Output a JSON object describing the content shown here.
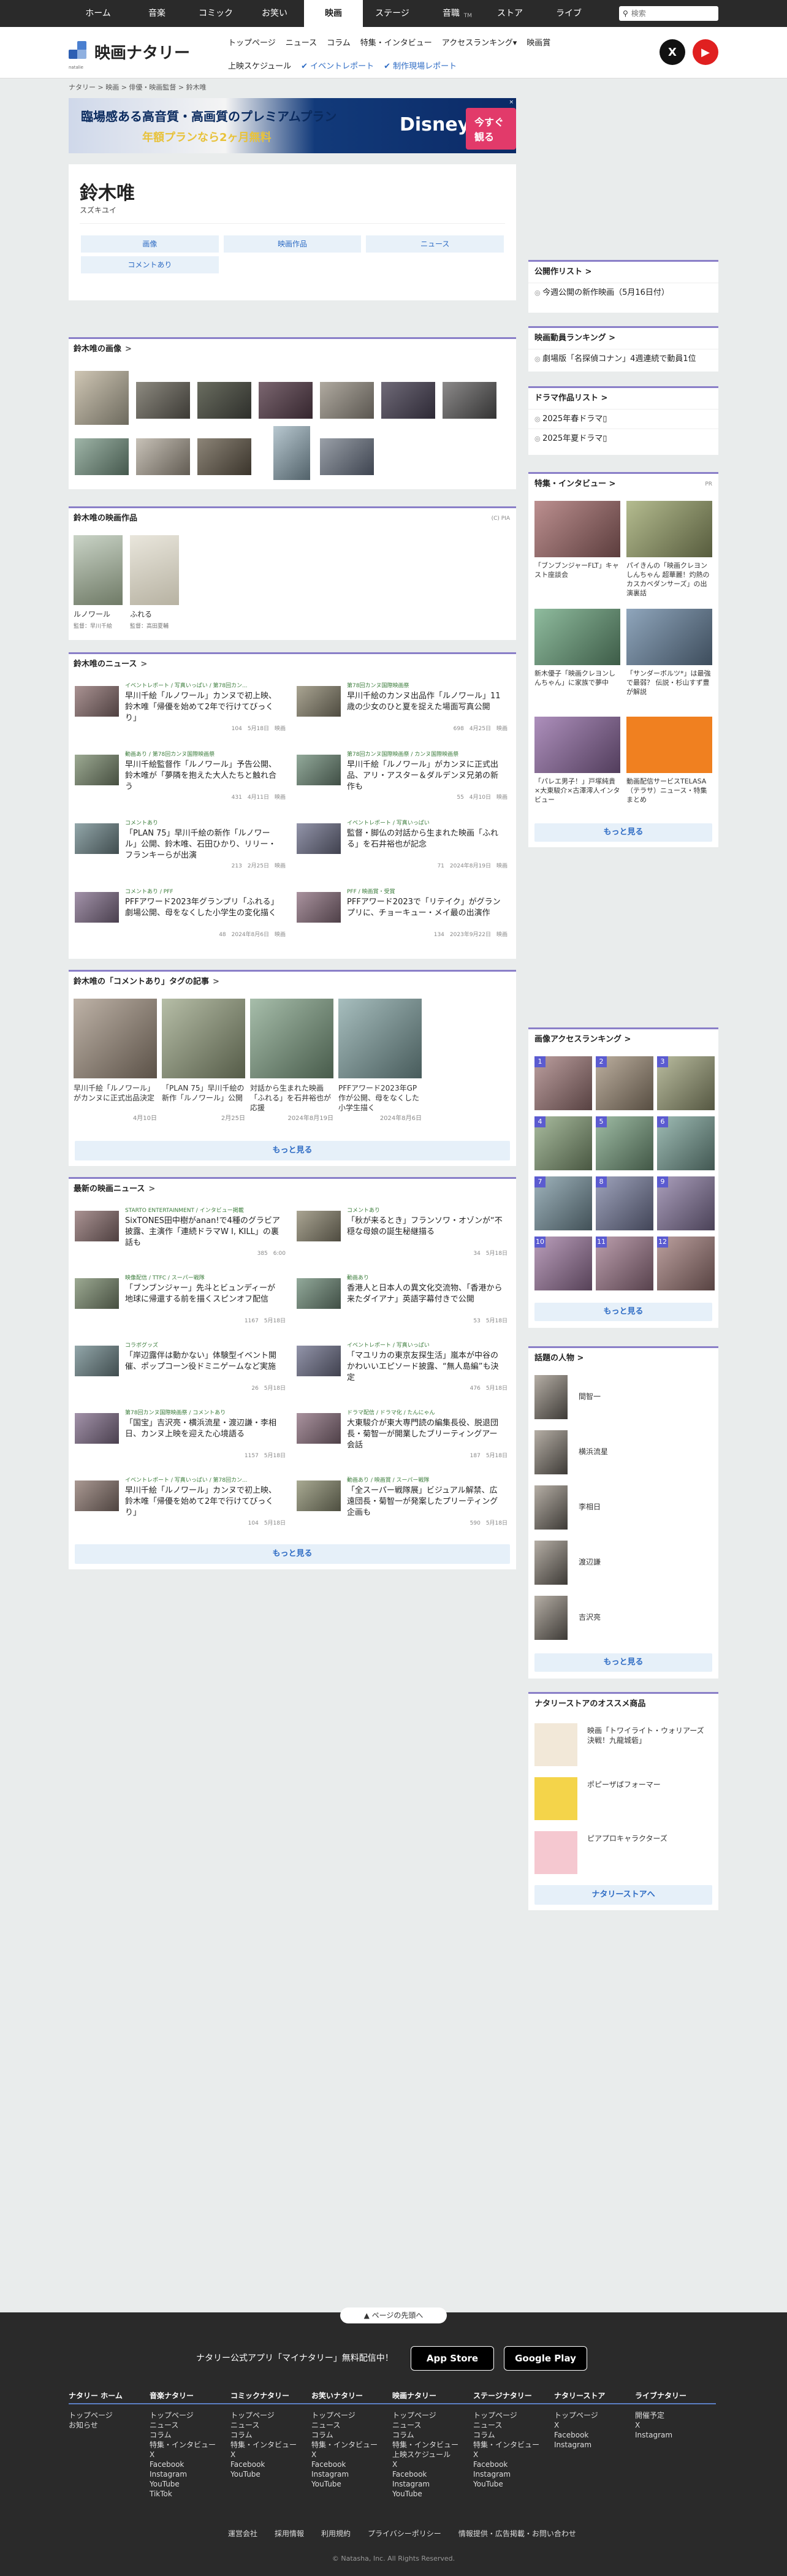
{
  "topnav": {
    "tabs": [
      "ホーム",
      "音楽",
      "コミック",
      "お笑い",
      "映画",
      "ステージ",
      "音職",
      "ストア",
      "ライブ"
    ],
    "active": 4,
    "sup": "TM",
    "search_placeholder": "検索"
  },
  "header": {
    "logo": "映画ナタリー",
    "logo_sub": "natalie",
    "nav1": [
      "トップページ",
      "ニュース",
      "コラム",
      "特集・インタビュー",
      "アクセスランキング▾",
      "映画賞"
    ],
    "nav2": [
      "上映スケジュール",
      "イベントレポート",
      "制作現場レポート"
    ]
  },
  "breadcrumb": "ナタリー > 映画 > 俳優・映画監督 > 鈴木唯",
  "ad": {
    "line1": "臨場感ある高音質・高画質のプレミアムプラン",
    "line2": "年額プランなら2ヶ月無料",
    "brand": "Disney+",
    "cta": "今すぐ観る",
    "close": "×"
  },
  "person": {
    "name": "鈴木唯",
    "kana": "スズキユイ",
    "tabs": [
      "画像",
      "映画作品",
      "ニュース",
      "コメントあり"
    ]
  },
  "images": {
    "title": "鈴木唯の画像"
  },
  "films": {
    "title": "鈴木唯の映画作品",
    "pa": "(C) PIA",
    "items": [
      {
        "title": "ルノワール",
        "dir": "監督：早川千絵"
      },
      {
        "title": "ふれる",
        "dir": "監督：高田夏輔"
      }
    ]
  },
  "news": {
    "title": "鈴木唯のニュース",
    "items": [
      {
        "tags": "イベントレポート / 写真いっぱい / 第78回カン...",
        "title": "早川千絵「ルノワール」カンヌで初上映、鈴木唯「帰優を始めて2年で行けてびっくり」",
        "meta": "104　5月18日　映画"
      },
      {
        "tags": "第78回カンヌ国際映画祭",
        "title": "早川千絵のカンヌ出品作「ルノワール」11歳の少女のひと夏を捉えた場面写真公開",
        "meta": "698　4月25日　映画"
      },
      {
        "tags": "動画あり / 第78回カンヌ国際映画祭",
        "title": "早川千絵監督作「ルノワール」予告公開、鈴木唯が「夢隣を抱えた大人たちと触れ合う",
        "meta": "431　4月11日　映画"
      },
      {
        "tags": "第78回カンヌ国際映画祭 / カンヌ国際映画祭",
        "title": "早川千絵「ルノワール」がカンヌに正式出品、アリ・アスター＆ダルデンヌ兄弟の新作も",
        "meta": "55　4月10日　映画"
      },
      {
        "tags": "コメントあり",
        "title": "「PLAN 75」早川千絵の新作「ルノワール」公開、鈴木唯、石田ひかり、リリー・フランキーらが出演",
        "meta": "213　2月25日　映画"
      },
      {
        "tags": "イベントレポート / 写真いっぱい",
        "title": "監督・脚仏の対話から生まれた映画「ふれる」を石井裕也が記念",
        "meta": "71　2024年8月19日　映画"
      },
      {
        "tags": "コメントあり / PFF",
        "title": "PFFアワード2023年グランプリ「ふれる」劇場公開、母をなくした小学生の変化描く",
        "meta": "48　2024年8月6日　映画"
      },
      {
        "tags": "PFF / 映画賞・受賞",
        "title": "PFFアワード2023で「リテイク」がグランプリに、チョーキュー・メイ最の出演作",
        "meta": "134　2023年9月22日　映画"
      }
    ]
  },
  "comment": {
    "title": "鈴木唯の「コメントあり」タグの記事",
    "more": "もっと見る",
    "items": [
      {
        "title": "早川千絵「ルノワール」がカンヌに正式出品決定",
        "date": "4月10日"
      },
      {
        "title": "「PLAN 75」早川千絵の新作「ルノワール」公開",
        "date": "2月25日"
      },
      {
        "title": "対話から生まれた映画「ふれる」を石井裕也が応援",
        "date": "2024年8月19日"
      },
      {
        "title": "PFFアワード2023年GP作が公開、母をなくした小学生描く",
        "date": "2024年8月6日"
      }
    ]
  },
  "latest": {
    "title": "最新の映画ニュース",
    "more": "もっと見る",
    "items": [
      {
        "tags": "STARTO ENTERTAINMENT / インタビュー掲載",
        "title": "SixTONES田中樹がanan!で4種のグラビア披露、主演作「連続ドラマW I, KILL」の裏話も",
        "meta": "385　6:00"
      },
      {
        "tags": "コメントあり",
        "title": "「秋が来るとき」フランソワ・オゾンが“不穏な母娘の誕生秘継描る",
        "meta": "34　5月18日"
      },
      {
        "tags": "映像配信 / TTFC / スーパー戦隊",
        "title": "「ブンブンジャー」先斗とビュンディーが地球に帰還する前を描くスピンオフ配信",
        "meta": "1167　5月18日"
      },
      {
        "tags": "動画あり",
        "title": "香港人と日本人の異文化交流物、「香港から来たダイアナ」英語字幕付きで公開",
        "meta": "53　5月18日"
      },
      {
        "tags": "コラボグッズ",
        "title": "「岸辺露伴は動かない」体験型イベント開催、ポップコーン役ドミニゲームなど実施",
        "meta": "26　5月18日"
      },
      {
        "tags": "イベントレポート / 写真いっぱい",
        "title": "「マユリカの東京友探生活」嵐本が中谷のかわいいエピソード披露、“無人島編”も決定",
        "meta": "476　5月18日"
      },
      {
        "tags": "第78回カンヌ国際映画祭 / コメントあり",
        "title": "「国宝」吉沢亮・横浜流星・渡辺謙・李相日、カンヌ上映を迎えた心境語る",
        "meta": "1157　5月18日"
      },
      {
        "tags": "ドラマ配信 / ドラマ化 / たんにゃん",
        "title": "大東駿介が東大専門読の編集長役、脱退団長・菊智一が開業したブリーティングアー会話",
        "meta": "187　5月18日"
      },
      {
        "tags": "イベントレポート / 写真いっぱい / 第78回カン...",
        "title": "早川千絵「ルノワール」カンヌで初上映、鈴木唯「帰優を始めて2年で行けてびっくり」",
        "meta": "104　5月18日"
      },
      {
        "tags": "動画あり / 映画賞 / スーパー戦隊",
        "title": "「全スーパー戦隊展」ビジュアル解禁、広遠団長・菊智一が発案したプリーティング企画も",
        "meta": "590　5月18日"
      }
    ]
  },
  "sidebar": {
    "kouhyo": {
      "title": "公開作リスト",
      "items": [
        "今週公開の新作映画（5月16日付）"
      ]
    },
    "ranking": {
      "title": "映画動員ランキング",
      "items": [
        "劇場版「名探偵コナン」4週連続で動員1位"
      ]
    },
    "drama": {
      "title": "ドラマ作品リスト",
      "items": [
        "2025年春ドラマ▯",
        "2025年夏ドラマ▯"
      ]
    },
    "tokushu": {
      "title": "特集・インタビュー",
      "pr": "PR",
      "more": "もっと見る",
      "items": [
        "「ブンブンジャーFLT」キャスト座談会",
        "パイきんの「映画クレヨンしんちゃん 超華麗！灼熱のカスカベダンサーズ」の出演裏話",
        "新木優子「映画クレヨンしんちゃん」に家族で夢中",
        "「サンダーボルツ*」は最強で最弱？ 伝説・杉山すず豊が解説",
        "「パレエ男子！」戸塚純貴×大東駿介×古澤澪人インタビュー",
        "動画配信サービスTELASA（テラサ）ニュース・特集まとめ"
      ]
    },
    "imgrank": {
      "title": "画像アクセスランキング",
      "more": "もっと見る"
    },
    "people": {
      "title": "話題の人物",
      "more": "もっと見る",
      "items": [
        "間智一",
        "横浜流星",
        "李相日",
        "渡辺謙",
        "吉沢亮"
      ]
    },
    "store": {
      "title": "ナタリーストアのオススメ商品",
      "button": "ナタリーストアへ",
      "items": [
        "映画「トワイライト・ウォリアーズ 決戦！九龍城砦」",
        "ポピーザぱフォーマー",
        "ピアプロキャラクターズ"
      ]
    }
  },
  "footer": {
    "pagetop": "▲ ページの先頭へ",
    "app": "ナタリー公式アプリ「マイナタリー」無料配信中！",
    "appstore": "App Store",
    "googleplay": "Google Play",
    "cols": [
      {
        "t": "ナタリー ホーム",
        "items": [
          "トップページ",
          "お知らせ"
        ]
      },
      {
        "t": "音楽ナタリー",
        "items": [
          "トップページ",
          "ニュース",
          "コラム",
          "特集・インタビュー",
          "X",
          "Facebook",
          "Instagram",
          "YouTube",
          "TikTok"
        ]
      },
      {
        "t": "コミックナタリー",
        "items": [
          "トップページ",
          "ニュース",
          "コラム",
          "特集・インタビュー",
          "X",
          "Facebook",
          "YouTube"
        ]
      },
      {
        "t": "お笑いナタリー",
        "items": [
          "トップページ",
          "ニュース",
          "コラム",
          "特集・インタビュー",
          "X",
          "Facebook",
          "Instagram",
          "YouTube"
        ]
      },
      {
        "t": "映画ナタリー",
        "items": [
          "トップページ",
          "ニュース",
          "コラム",
          "特集・インタビュー",
          "上映スケジュール",
          "X",
          "Facebook",
          "Instagram",
          "YouTube"
        ]
      },
      {
        "t": "ステージナタリー",
        "items": [
          "トップページ",
          "ニュース",
          "コラム",
          "特集・インタビュー",
          "X",
          "Facebook",
          "Instagram",
          "YouTube"
        ]
      },
      {
        "t": "ナタリーストア",
        "items": [
          "トップページ",
          "X",
          "Facebook",
          "Instagram"
        ]
      },
      {
        "t": "ライブナタリー",
        "items": [
          "開催予定",
          "X",
          "Instagram"
        ]
      }
    ],
    "links": [
      "運営会社",
      "採用情報",
      "利用規約",
      "プライバシーポリシー",
      "情報提供・広告掲載・お問い合わせ"
    ],
    "copy": "© Natasha, Inc. All Rights Reserved."
  }
}
